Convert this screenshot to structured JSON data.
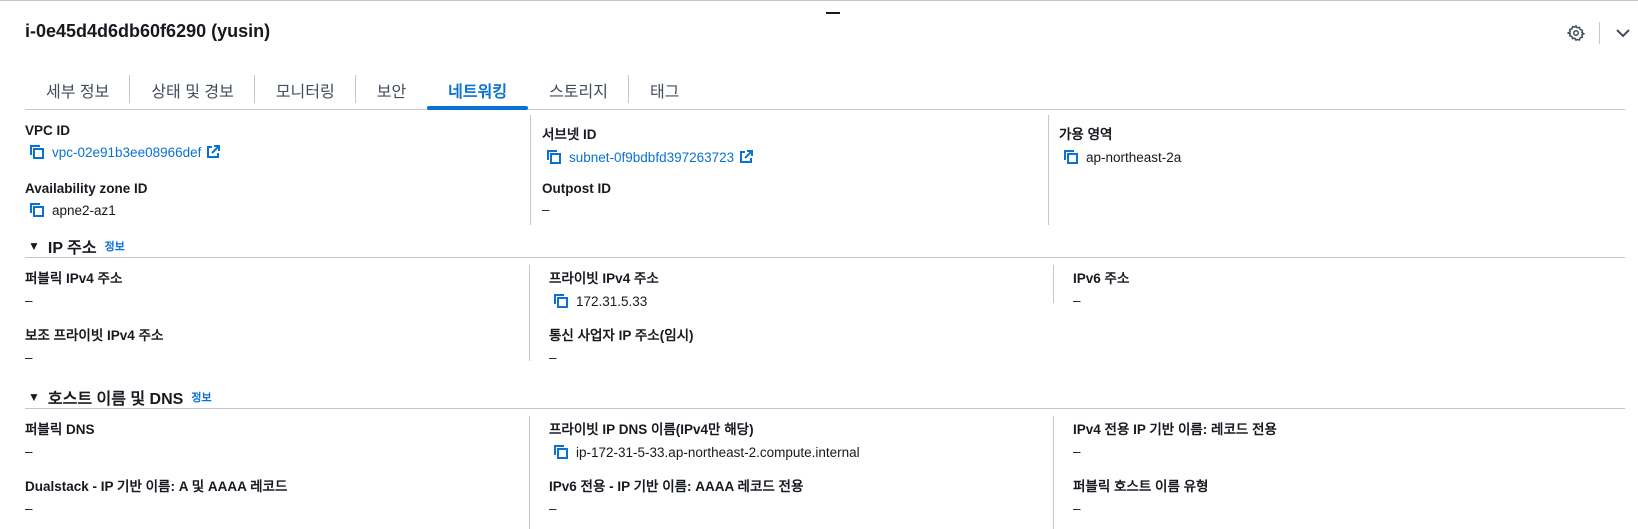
{
  "instance": {
    "title": "i-0e45d4d6db60f6290 (yusin)"
  },
  "header": {
    "settings_icon": "gear-icon",
    "collapse_icon": "chevron-down-icon"
  },
  "tabs": [
    {
      "label": "세부 정보"
    },
    {
      "label": "상태 및 경보"
    },
    {
      "label": "모니터링"
    },
    {
      "label": "보안"
    },
    {
      "label": "네트워킹",
      "active": true
    },
    {
      "label": "스토리지"
    },
    {
      "label": "태그"
    }
  ],
  "network": {
    "vpc_id": {
      "label": "VPC ID",
      "value": "vpc-02e91b3ee08966def"
    },
    "subnet_id": {
      "label": "서브넷 ID",
      "value": "subnet-0f9bdbfd397263723"
    },
    "availability_zone": {
      "label": "가용 영역",
      "value": "ap-northeast-2a"
    },
    "availability_zone_id": {
      "label": "Availability zone ID",
      "value": "apne2-az1"
    },
    "outpost_id": {
      "label": "Outpost ID",
      "value": "–"
    }
  },
  "ip_section": {
    "title": "IP 주소",
    "info": "정보",
    "public_ipv4": {
      "label": "퍼블릭 IPv4 주소",
      "value": "–"
    },
    "private_ipv4": {
      "label": "프라이빗 IPv4 주소",
      "value": "172.31.5.33"
    },
    "ipv6": {
      "label": "IPv6 주소",
      "value": "–"
    },
    "secondary_private_ipv4": {
      "label": "보조 프라이빗 IPv4 주소",
      "value": "–"
    },
    "carrier_ip": {
      "label": "통신 사업자 IP 주소(임시)",
      "value": "–"
    }
  },
  "dns_section": {
    "title": "호스트 이름 및 DNS",
    "info": "정보",
    "public_dns": {
      "label": "퍼블릭 DNS",
      "value": "–"
    },
    "private_ip_dns": {
      "label": "프라이빗 IP DNS 이름(IPv4만 해당)",
      "value": "ip-172-31-5-33.ap-northeast-2.compute.internal"
    },
    "ipv4_only_name": {
      "label": "IPv4 전용 IP 기반 이름: 레코드 전용",
      "value": "–"
    },
    "dualstack": {
      "label": "Dualstack - IP 기반 이름: A 및 AAAA 레코드",
      "value": "–"
    },
    "ipv6_only": {
      "label": "IPv6 전용 - IP 기반 이름: AAAA 레코드 전용",
      "value": "–"
    },
    "public_hostname_type": {
      "label": "퍼블릭 호스트 이름 유형",
      "value": "–"
    }
  },
  "colors": {
    "link": "#0972d3",
    "text": "#16191f",
    "divider": "#c6c6cd"
  }
}
